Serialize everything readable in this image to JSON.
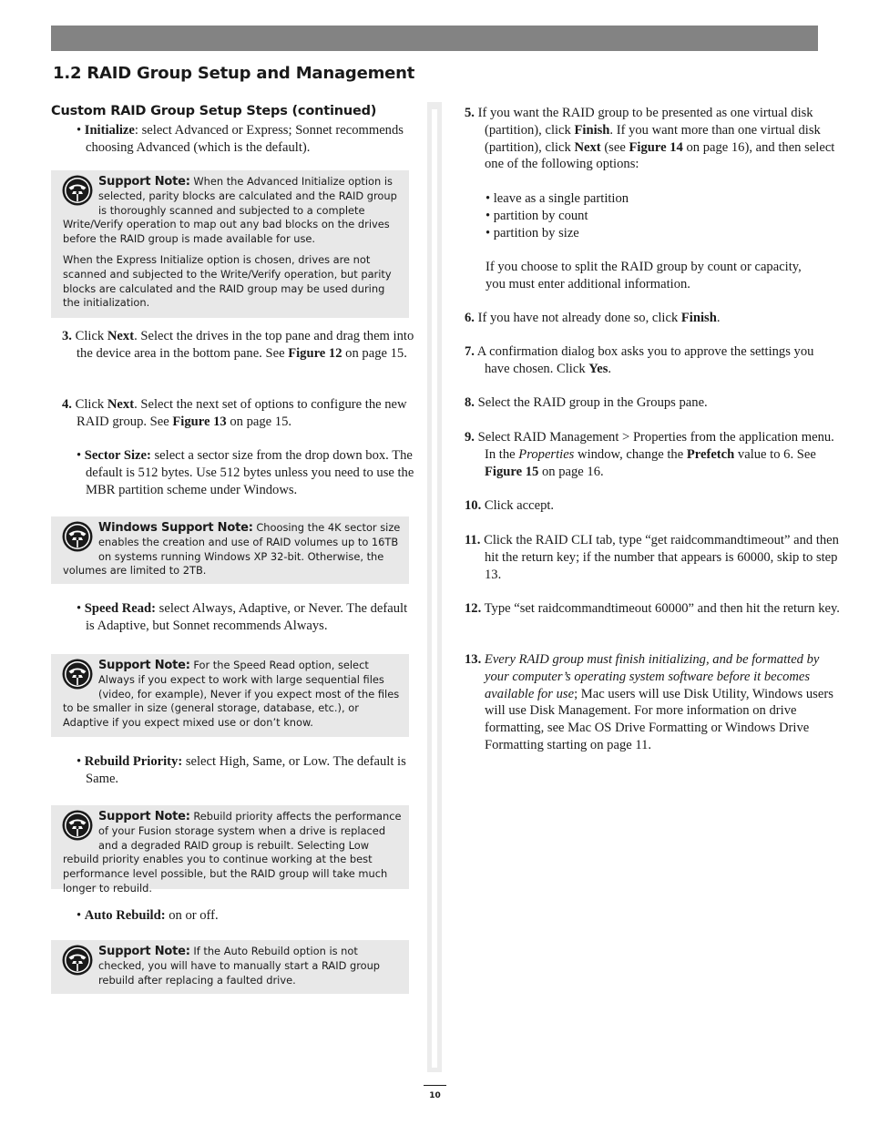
{
  "section_title": "1.2 RAID Group Setup and Management",
  "subsection_title": "Custom RAID Group Setup Steps (continued)",
  "left_column": {
    "initialize": {
      "label": "Initialize",
      "text": ": select Advanced or Express; Sonnet recommends choosing Advanced (which is the default)."
    },
    "note_initialize": {
      "icon": "telephone-icon",
      "label": "Support Note:",
      "para1": " When the Advanced Initialize option is selected, parity blocks are calculated and the RAID group is thoroughly scanned and subjected to a complete Write/Verify operation to map out any bad blocks on the drives before the RAID group is made available for use.",
      "para2": "When the Express Initialize option is chosen, drives are not scanned and subjected to the Write/Verify operation, but parity blocks are calculated and the RAID group may be used during the initialization."
    },
    "step3": {
      "num": "3.",
      "pre": " Click ",
      "b1": "Next",
      "mid": ". Select the drives in the top pane and drag them into the device area in the bottom pane. See ",
      "b2": "Figure 12",
      "post": " on page 15."
    },
    "step4": {
      "num": "4.",
      "pre": " Click ",
      "b1": "Next",
      "mid": ". Select the next set of options to configure the new RAID group. See ",
      "b2": "Figure 13",
      "post": " on page 15."
    },
    "sector_size": {
      "label": "Sector Size:",
      "text": " select a sector size from the drop down box. The default is 512 bytes. Use 512 bytes unless you need to use the MBR partition scheme under Windows."
    },
    "note_windows": {
      "icon": "telephone-icon",
      "label": "Windows Support Note:",
      "para1": " Choosing the 4K sector size enables the creation and use of RAID volumes up to 16TB on systems running Windows XP 32-bit. Otherwise, the volumes are limited to 2TB."
    },
    "speed_read": {
      "label": "Speed Read:",
      "text": " select Always, Adaptive, or Never. The default is Adaptive, but Sonnet recommends Always."
    },
    "note_speed": {
      "icon": "telephone-icon",
      "label": "Support Note:",
      "para1": " For the Speed Read option, select Always if you expect to work with large sequential files (video, for example), Never if you expect most of the files to be smaller in size (general storage, database, etc.), or Adaptive if you expect mixed use or don’t know."
    },
    "rebuild_priority": {
      "label": "Rebuild Priority:",
      "text": " select High, Same, or Low. The default is Same."
    },
    "note_rebuild": {
      "icon": "telephone-icon",
      "label": "Support Note:",
      "para1": " Rebuild priority affects the performance of your Fusion storage system when a drive is replaced and a degraded RAID group is rebuilt. Selecting Low rebuild priority enables you to continue working at the best performance level possible, but the RAID group will take much longer to rebuild."
    },
    "auto_rebuild": {
      "label": "Auto Rebuild:",
      "text": " on or off."
    },
    "note_auto": {
      "icon": "telephone-icon",
      "label": "Support Note:",
      "para1": " If the Auto Rebuild option is not checked, you will have to manually start a RAID group rebuild after replacing a faulted drive."
    }
  },
  "right_column": {
    "step5": {
      "num": "5.",
      "t1": " If you want the RAID group to be presented as one virtual disk (partition), click ",
      "b1": "Finish",
      "t2": ". If you want more than one virtual disk (partition), click ",
      "b2": "Next",
      "t3": " (see ",
      "b3": "Figure 14",
      "t4": " on page 16), and then select one of the following options:",
      "options": [
        "• leave as a single partition",
        "• partition by count",
        "• partition by size"
      ],
      "followup": "If you choose to split the RAID group by count or capacity, you must enter additional information."
    },
    "step6": {
      "num": "6.",
      "t1": " If you have not already done so, click ",
      "b1": "Finish",
      "t2": "."
    },
    "step7": {
      "num": "7.",
      "t1": " A confirmation dialog box asks you to approve the settings you have chosen. Click ",
      "b1": "Yes",
      "t2": "."
    },
    "step8": {
      "num": "8.",
      "t1": " Select the RAID group in the Groups pane."
    },
    "step9": {
      "num": "9.",
      "t1": " Select RAID Management > Properties from the application menu. In the ",
      "i1": "Properties",
      "t2": " window, change the ",
      "b1": "Prefetch",
      "t3": " value to 6. See ",
      "b2": "Figure 15",
      "t4": " on page 16."
    },
    "step10": {
      "num": "10.",
      "t1": " Click accept."
    },
    "step11": {
      "num": "11.",
      "t1": " Click the RAID CLI tab, type “get raidcommandtimeout” and then hit the return key; if the number that appears is 60000, skip to step 13."
    },
    "step12": {
      "num": "12.",
      "t1": " Type “set raidcommandtimeout 60000” and then hit the return key."
    },
    "step13": {
      "num": "13.",
      "i1": " Every RAID group must finish initializing, and be formatted by your computer’s operating system software before it becomes available for use",
      "t1": "; Mac users will use Disk Utility, Windows users will use Disk Management. For more information on drive formatting, see Mac OS Drive Formatting or Windows Drive Formatting starting on page 11."
    }
  },
  "footer": {
    "page_number": "10"
  },
  "colors": {
    "header_bar": "#838383",
    "note_background": "#e8e8e8",
    "divider": "#ececec",
    "text": "#1a1a1a"
  }
}
